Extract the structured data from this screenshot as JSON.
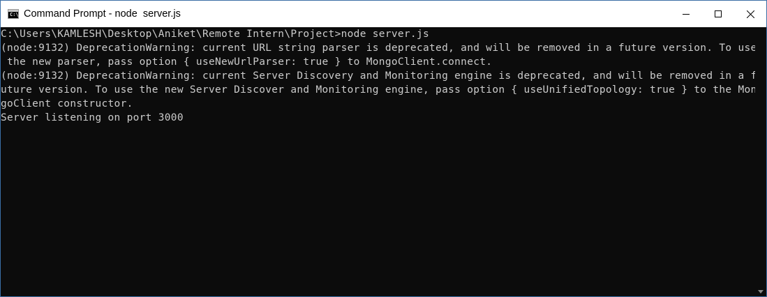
{
  "window": {
    "title": "Command Prompt - node  server.js",
    "icon": "cmd-icon",
    "icon_text": "C:\\",
    "title_bg": "#ffffff",
    "console_bg": "#0c0c0c",
    "text_color": "#cccccc"
  },
  "controls": {
    "minimize": "minimize-icon",
    "maximize": "maximize-icon",
    "close": "close-icon"
  },
  "console": {
    "lines": [
      "C:\\Users\\KAMLESH\\Desktop\\Aniket\\Remote Intern\\Project>node server.js",
      "(node:9132) DeprecationWarning: current URL string parser is deprecated, and will be removed in a future version. To use",
      " the new parser, pass option { useNewUrlParser: true } to MongoClient.connect.",
      "(node:9132) DeprecationWarning: current Server Discovery and Monitoring engine is deprecated, and will be removed in a f",
      "uture version. To use the new Server Discover and Monitoring engine, pass option { useUnifiedTopology: true } to the Mon",
      "goClient constructor.",
      "Server listening on port 3000"
    ]
  }
}
